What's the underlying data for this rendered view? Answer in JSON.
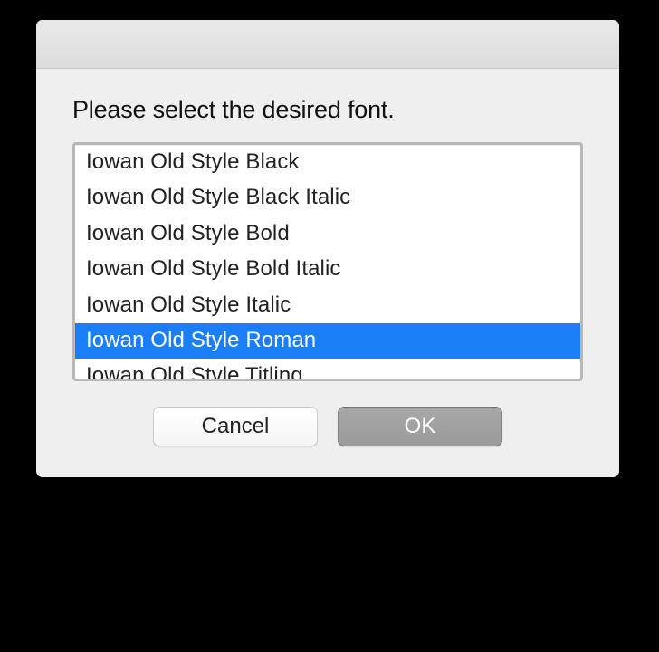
{
  "dialog": {
    "prompt": "Please select the desired font.",
    "items": [
      {
        "label": "Iowan Old Style Black",
        "selected": false
      },
      {
        "label": "Iowan Old Style Black Italic",
        "selected": false
      },
      {
        "label": "Iowan Old Style Bold",
        "selected": false
      },
      {
        "label": "Iowan Old Style Bold Italic",
        "selected": false
      },
      {
        "label": "Iowan Old Style Italic",
        "selected": false
      },
      {
        "label": "Iowan Old Style Roman",
        "selected": true
      },
      {
        "label": "Iowan Old Style Titling",
        "selected": false
      }
    ],
    "cancel_label": "Cancel",
    "ok_label": "OK"
  }
}
